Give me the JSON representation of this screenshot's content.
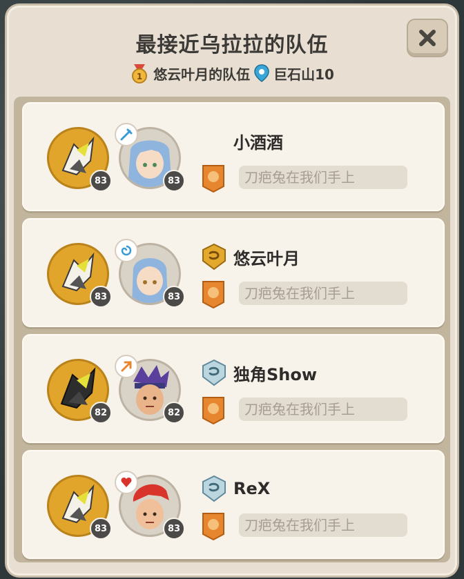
{
  "header": {
    "title": "最接近乌拉拉的队伍",
    "team_label": "悠云叶月的队伍",
    "rank_number": "1",
    "location": "巨石山10"
  },
  "close_button": {
    "icon": "close-x-icon"
  },
  "teams": [
    {
      "player_name": "小酒酒",
      "rank_badge": null,
      "pet_level": "83",
      "trainer_level": "83",
      "element_icon": "ice-sword-icon",
      "guild_name": "刀疤兔在我们手上"
    },
    {
      "player_name": "悠云叶月",
      "rank_badge": "gold-shield-icon",
      "pet_level": "83",
      "trainer_level": "83",
      "element_icon": "swirl-icon",
      "guild_name": "刀疤兔在我们手上"
    },
    {
      "player_name": "独角Show",
      "rank_badge": "silver-shield-icon",
      "pet_level": "82",
      "trainer_level": "82",
      "element_icon": "fire-bolt-icon",
      "guild_name": "刀疤兔在我们手上"
    },
    {
      "player_name": "ReX",
      "rank_badge": "silver-shield-icon",
      "pet_level": "83",
      "trainer_level": "83",
      "element_icon": "red-heart-icon",
      "guild_name": "刀疤兔在我们手上"
    }
  ],
  "colors": {
    "panel": "#e8dfd2",
    "row": "#f7f2ea",
    "pet_bg": "#e0a52a",
    "guild_pill": "#e3dcd1",
    "level_badge": "#4b4a49"
  }
}
